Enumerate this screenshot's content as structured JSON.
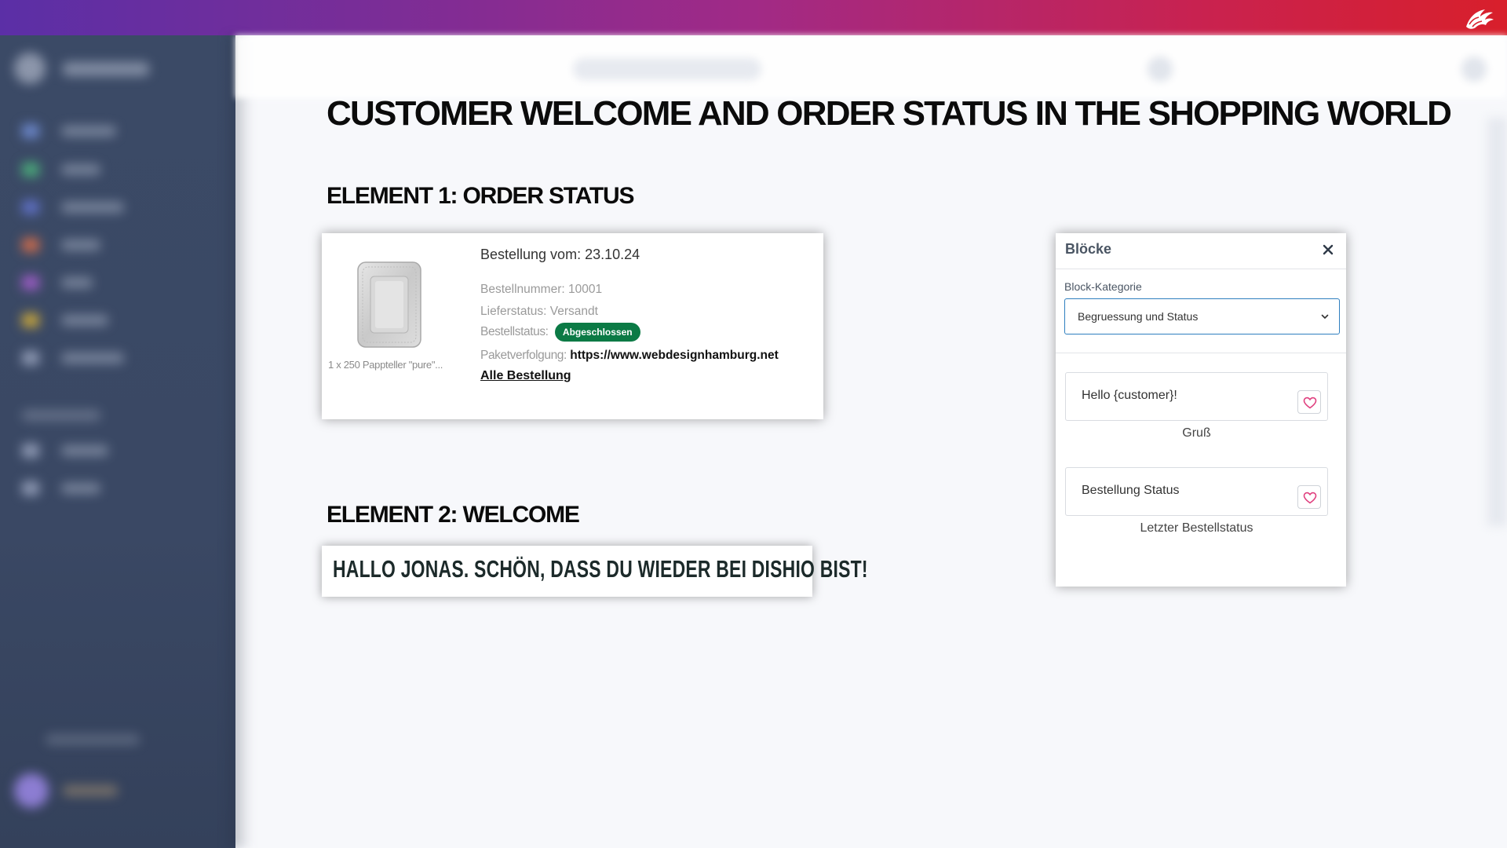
{
  "main_title": "CUSTOMER WELCOME AND ORDER STATUS IN THE SHOPPING WORLD",
  "element1": {
    "heading": "ELEMENT 1: ORDER STATUS",
    "product_caption": "1 x 250 Pappteller \"pure\"...",
    "order_date": "Bestellung vom: 23.10.24",
    "order_number": "Bestellnummer: 10001",
    "delivery_status": "Lieferstatus: Versandt",
    "order_status_label": "Bestellstatus:",
    "order_status_badge": "Abgeschlossen",
    "tracking_label": "Paketverfolgung:",
    "tracking_url": "https://www.webdesignhamburg.net",
    "all_orders_link": "Alle Bestellung"
  },
  "element2": {
    "heading": "ELEMENT 2: WELCOME",
    "welcome_text": "HALLO JONAS. SCHÖN, DASS DU WIEDER BEI DISHIO BIST!"
  },
  "blocks_panel": {
    "title": "Blöcke",
    "category_label": "Block-Kategorie",
    "category_selected": "Begruessung und Status",
    "blocks": [
      {
        "text": "Hello {customer}!",
        "caption": "Gruß"
      },
      {
        "text": "Bestellung Status",
        "caption": "Letzter Bestellstatus"
      }
    ]
  },
  "colors": {
    "badge_green": "#0b7a45",
    "select_border": "#2f7fbf",
    "favorite_pink": "#e0407f",
    "topbar_start": "#5b2fa6",
    "topbar_end": "#d81f2b"
  },
  "icons": {
    "close": "close-icon",
    "chevron": "chevron-down-icon",
    "favorite": "heart-icon",
    "brand": "dragon-logo-icon"
  }
}
